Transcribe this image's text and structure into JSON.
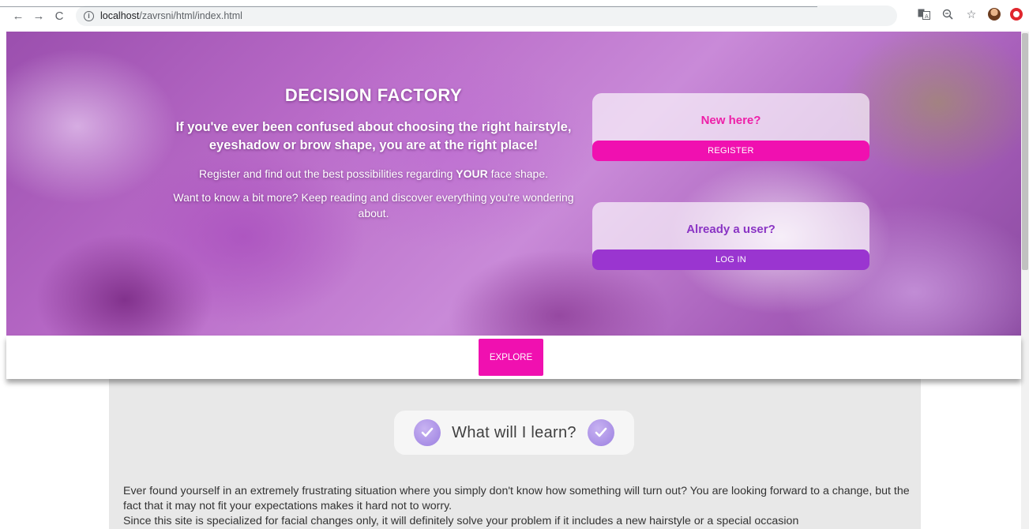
{
  "browser": {
    "url_host": "localhost",
    "url_path": "/zavrsni/html/index.html",
    "icons": [
      "back-arrow-icon",
      "forward-arrow-icon",
      "reload-icon",
      "info-icon",
      "translate-icon",
      "zoom-icon",
      "star-icon",
      "profile-avatar-icon",
      "opera-icon"
    ]
  },
  "hero": {
    "title": "DECISION FACTORY",
    "tagline": "If you've ever been confused about choosing the right hairstyle, eyeshadow or brow shape, you are at the right place!",
    "register_text_before": "Register and find out the best possibilities regarding ",
    "register_text_emphasis": "YOUR",
    "register_text_after": " face shape.",
    "more_text": "Want to know a bit more? Keep reading and discover everything you're wondering about."
  },
  "auth": {
    "register_question": "New here?",
    "register_button": "REGISTER",
    "login_question": "Already a user?",
    "login_button": "LOG IN"
  },
  "explore": {
    "button_label": "EXPLORE"
  },
  "content": {
    "section_title": "What will I learn?",
    "paragraph_1": "Ever found yourself in an extremely frustrating situation where you simply don't know how something will turn out? You are looking forward to a change, but the fact that it may not fit your expectations makes it hard not to worry.",
    "paragraph_2": "Since this site is specialized for facial changes only, it will definitely solve your problem if it includes a new hairstyle or a special occasion"
  },
  "colors": {
    "register_accent": "#f010b0",
    "login_accent": "#9a35d0",
    "register_text": "#ee1fa8",
    "login_text": "#8a34c4",
    "check_icon": "#9b7fe0"
  }
}
